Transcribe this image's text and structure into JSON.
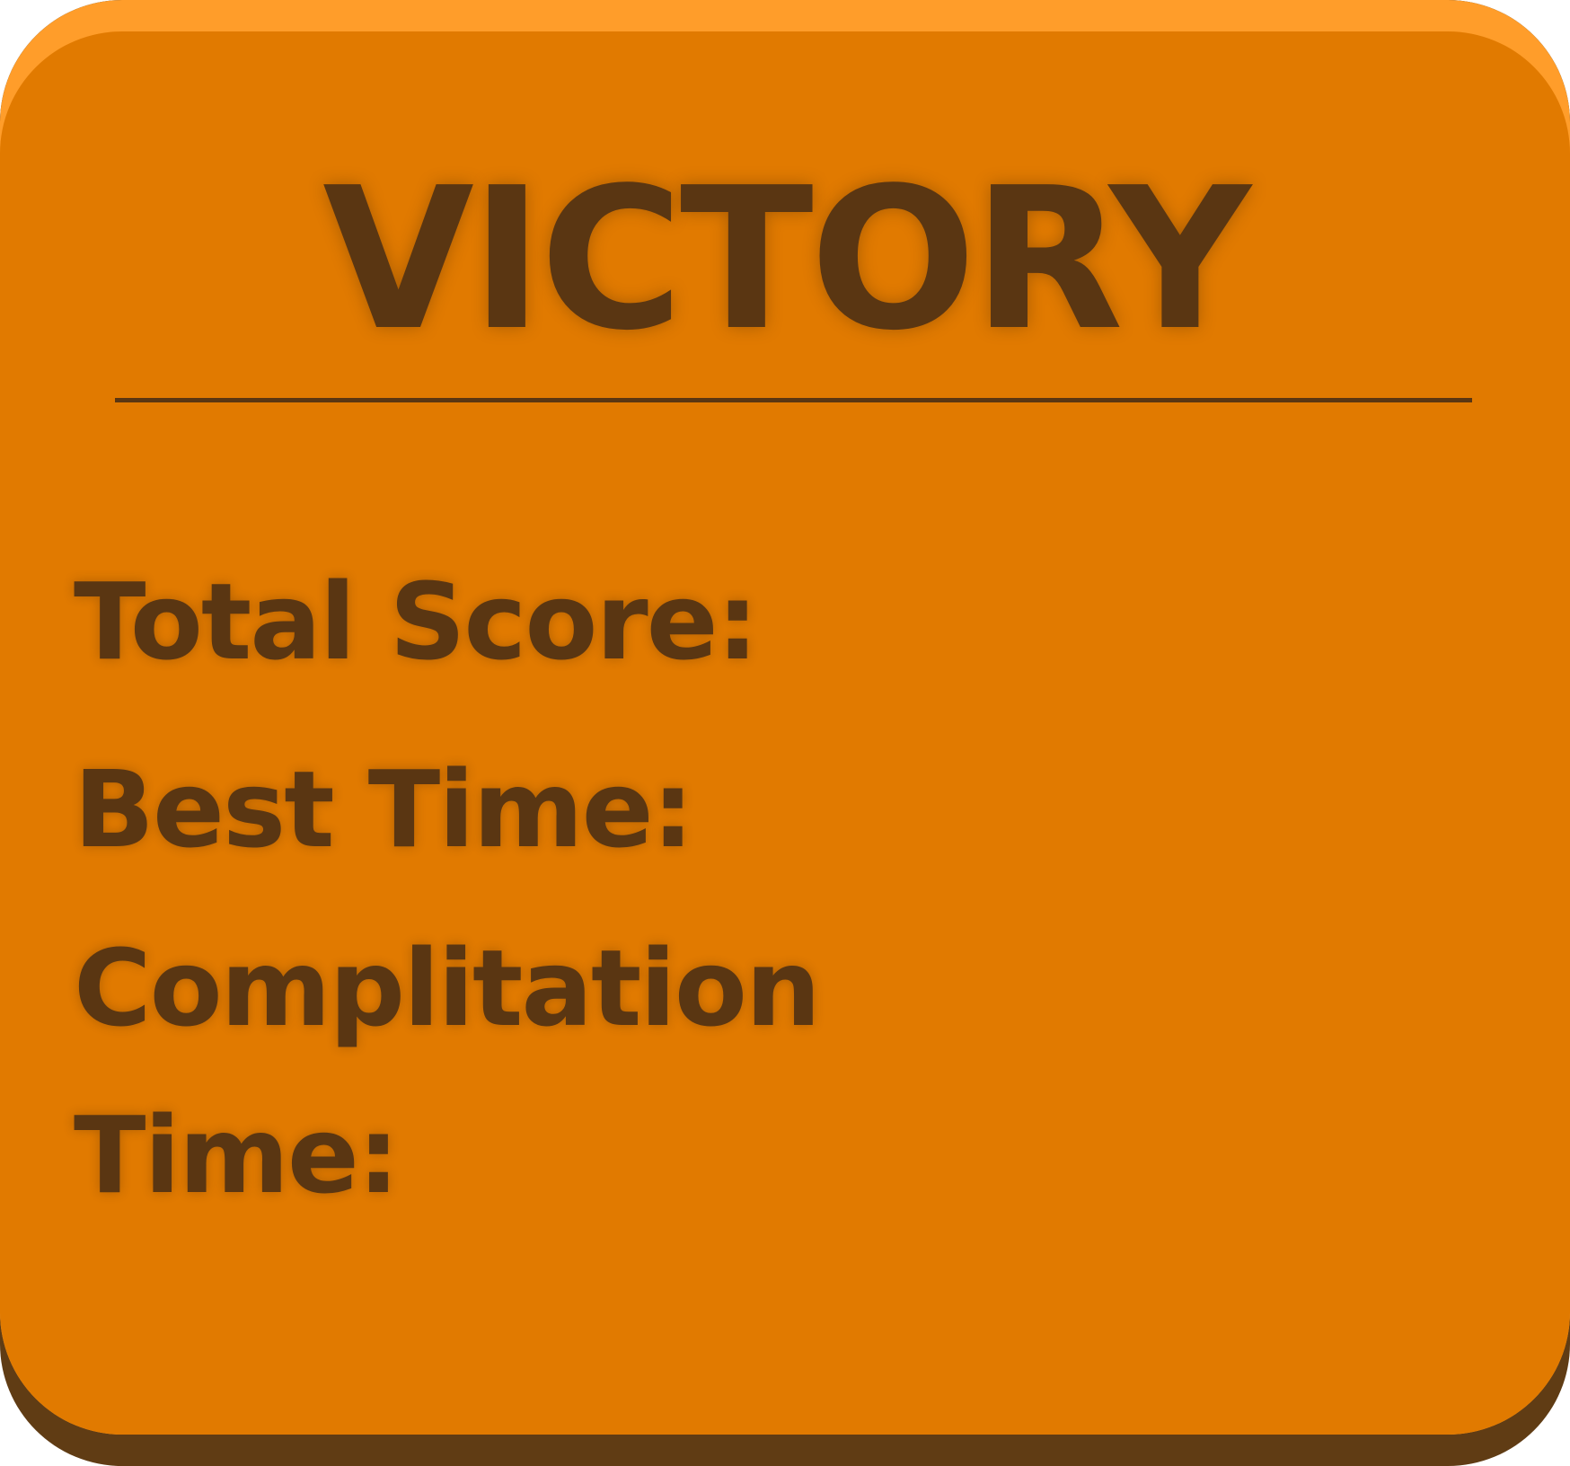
{
  "victory_panel": {
    "title": "VICTORY",
    "stats": {
      "total_score_label": "Total Score:",
      "best_time_label": "Best Time:",
      "completion_time_label": "Complitation Time:"
    }
  },
  "colors": {
    "panel_face": "#e17a00",
    "panel_highlight": "#ff9d2a",
    "panel_shadow": "#603c14",
    "text": "#5a3612"
  }
}
